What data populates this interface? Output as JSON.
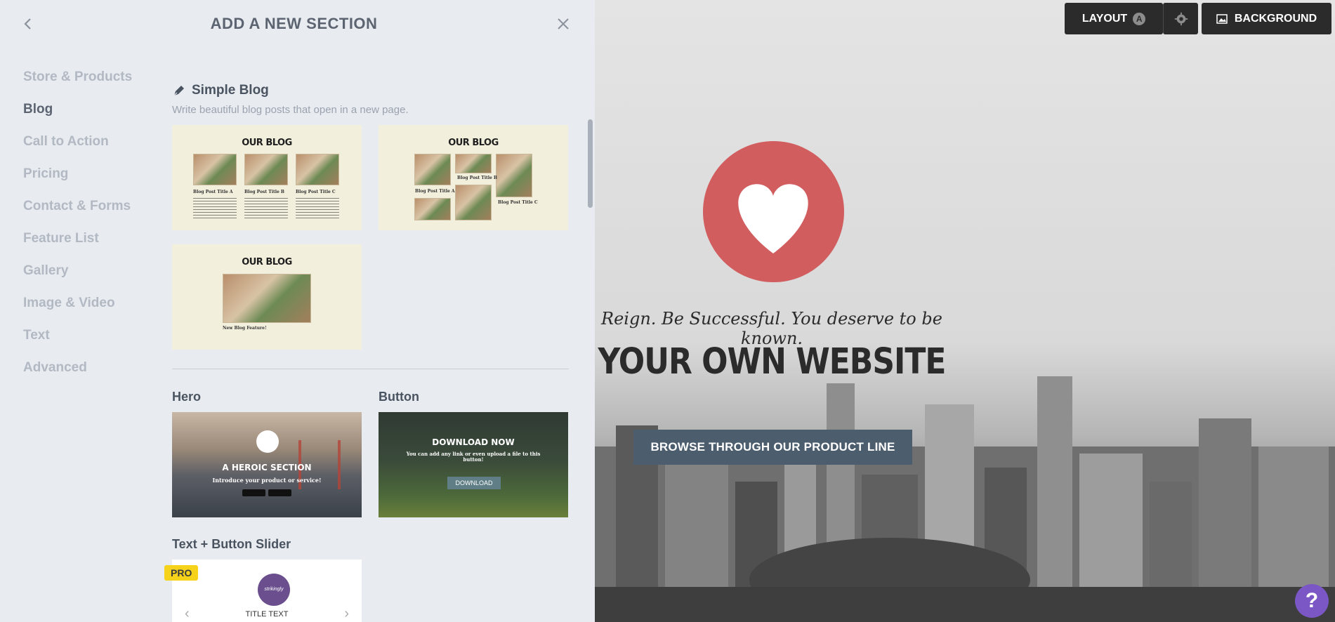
{
  "panel": {
    "title": "ADD A NEW SECTION"
  },
  "categories": [
    {
      "label": "Store & Products"
    },
    {
      "label": "Blog"
    },
    {
      "label": "Call to Action"
    },
    {
      "label": "Pricing"
    },
    {
      "label": "Contact & Forms"
    },
    {
      "label": "Feature List"
    },
    {
      "label": "Gallery"
    },
    {
      "label": "Image & Video"
    },
    {
      "label": "Text"
    },
    {
      "label": "Advanced"
    }
  ],
  "blog_section": {
    "title": "Simple Blog",
    "description": "Write beautiful blog posts that open in a new page.",
    "thumb_title": "OUR BLOG",
    "post_a": "Blog Post Title A",
    "post_b": "Blog Post Title B",
    "post_c": "Blog Post Title C",
    "feature": "New Blog Feature!"
  },
  "hero_section": {
    "label": "Hero",
    "thumb_title": "A HEROIC SECTION",
    "thumb_sub": "Introduce your product or service!"
  },
  "button_section": {
    "label": "Button",
    "thumb_title": "DOWNLOAD NOW",
    "thumb_sub": "You can add any link or even upload a file to this button!",
    "thumb_button": "DOWNLOAD"
  },
  "slider_section": {
    "label": "Text + Button Slider",
    "badge": "PRO",
    "logo_text": "strikingly",
    "thumb_text": "TITLE TEXT"
  },
  "toolbar": {
    "layout_label": "LAYOUT",
    "layout_badge": "A",
    "background_label": "BACKGROUND"
  },
  "preview": {
    "tagline": "Reign. Be Successful. You deserve to be known.",
    "title": "YOUR OWN WEBSITE",
    "cta": "BROWSE THROUGH OUR PRODUCT LINE",
    "help": "?"
  },
  "colors": {
    "accent_red": "#d15d5f",
    "cta_bg": "#4c5d6e",
    "pro_badge": "#f6d21a",
    "help_purple": "#7b57c6"
  }
}
